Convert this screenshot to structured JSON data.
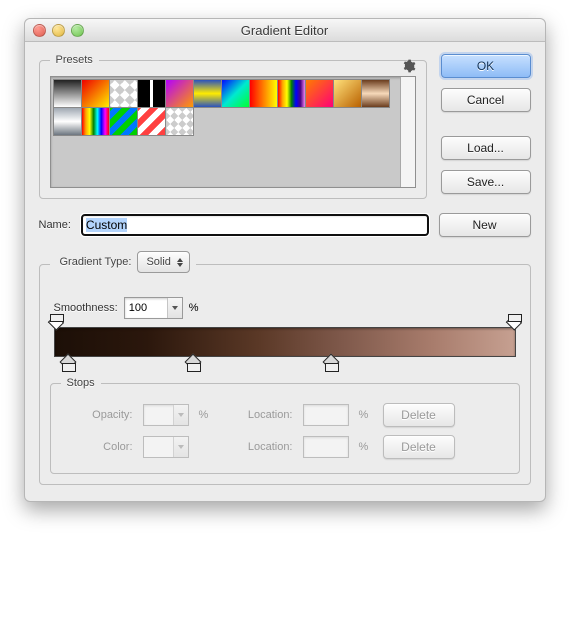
{
  "window": {
    "title": "Gradient Editor"
  },
  "buttons": {
    "ok": "OK",
    "cancel": "Cancel",
    "load": "Load...",
    "save": "Save...",
    "new": "New"
  },
  "presets": {
    "legend": "Presets"
  },
  "name": {
    "label": "Name:",
    "value": "Custom"
  },
  "gradient_type": {
    "legend": "Gradient Type:",
    "selected": "Solid",
    "smoothness_label": "Smoothness:",
    "smoothness_value": "100",
    "smoothness_unit": "%"
  },
  "gradient_bar": {
    "opacity_stops_pct": [
      0,
      100
    ],
    "color_stops_pct": [
      3,
      30,
      60
    ],
    "css": "linear-gradient(to right, #1c0f07 0%, #2b170c 20%, #5a3826 44%, #7e584a 62%, #a87c6c 82%, #c6a091 100%)"
  },
  "stops": {
    "legend": "Stops",
    "opacity_label": "Opacity:",
    "color_label": "Color:",
    "location_label": "Location:",
    "unit": "%",
    "delete": "Delete"
  }
}
